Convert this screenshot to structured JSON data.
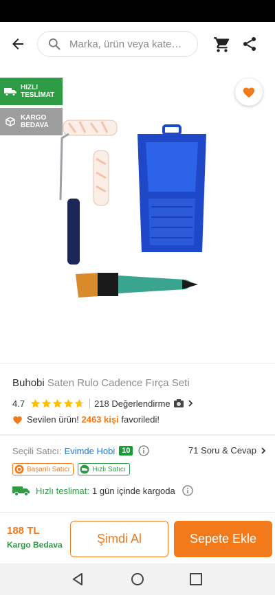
{
  "search": {
    "placeholder": "Marka, ürün veya kate…"
  },
  "badges": {
    "fast_delivery": [
      "HIZLI",
      "TESLİMAT"
    ],
    "free_cargo": [
      "KARGO",
      "BEDAVA"
    ]
  },
  "product": {
    "brand": "Buhobi",
    "name": "Saten Rulo Cadence Fırça Seti",
    "rating": "4.7",
    "stars": 4.7,
    "reviews": "218 Değerlendirme",
    "fav_prefix": "Sevilen ürün!",
    "fav_count": "2463 kişi",
    "fav_suffix": "favoriledi!"
  },
  "seller": {
    "label": "Seçili Satıcı:",
    "name": "Evimde Hobi",
    "score": "10",
    "qa": "71 Soru & Cevap",
    "tags": [
      "Başarılı Satıcı",
      "Hızlı Satıcı"
    ],
    "delivery_label": "Hızlı teslimat:",
    "delivery_text": "1 gün içinde kargoda"
  },
  "bottom": {
    "price": "188 TL",
    "cargo": "Kargo Bedava",
    "buy_now": "Şimdi Al",
    "add_to_cart": "Sepete Ekle"
  },
  "colors": {
    "accent": "#f27a1a",
    "green": "#2e9b45",
    "link": "#2b73c8"
  },
  "icons": [
    "back-arrow-icon",
    "search-icon",
    "cart-icon",
    "share-icon",
    "heart-icon",
    "truck-icon",
    "box-icon",
    "star-icon",
    "camera-icon",
    "chevron-right-icon",
    "info-icon",
    "medal-icon",
    "fast-seller-icon",
    "nav-back-icon",
    "nav-home-icon",
    "nav-recents-icon"
  ]
}
